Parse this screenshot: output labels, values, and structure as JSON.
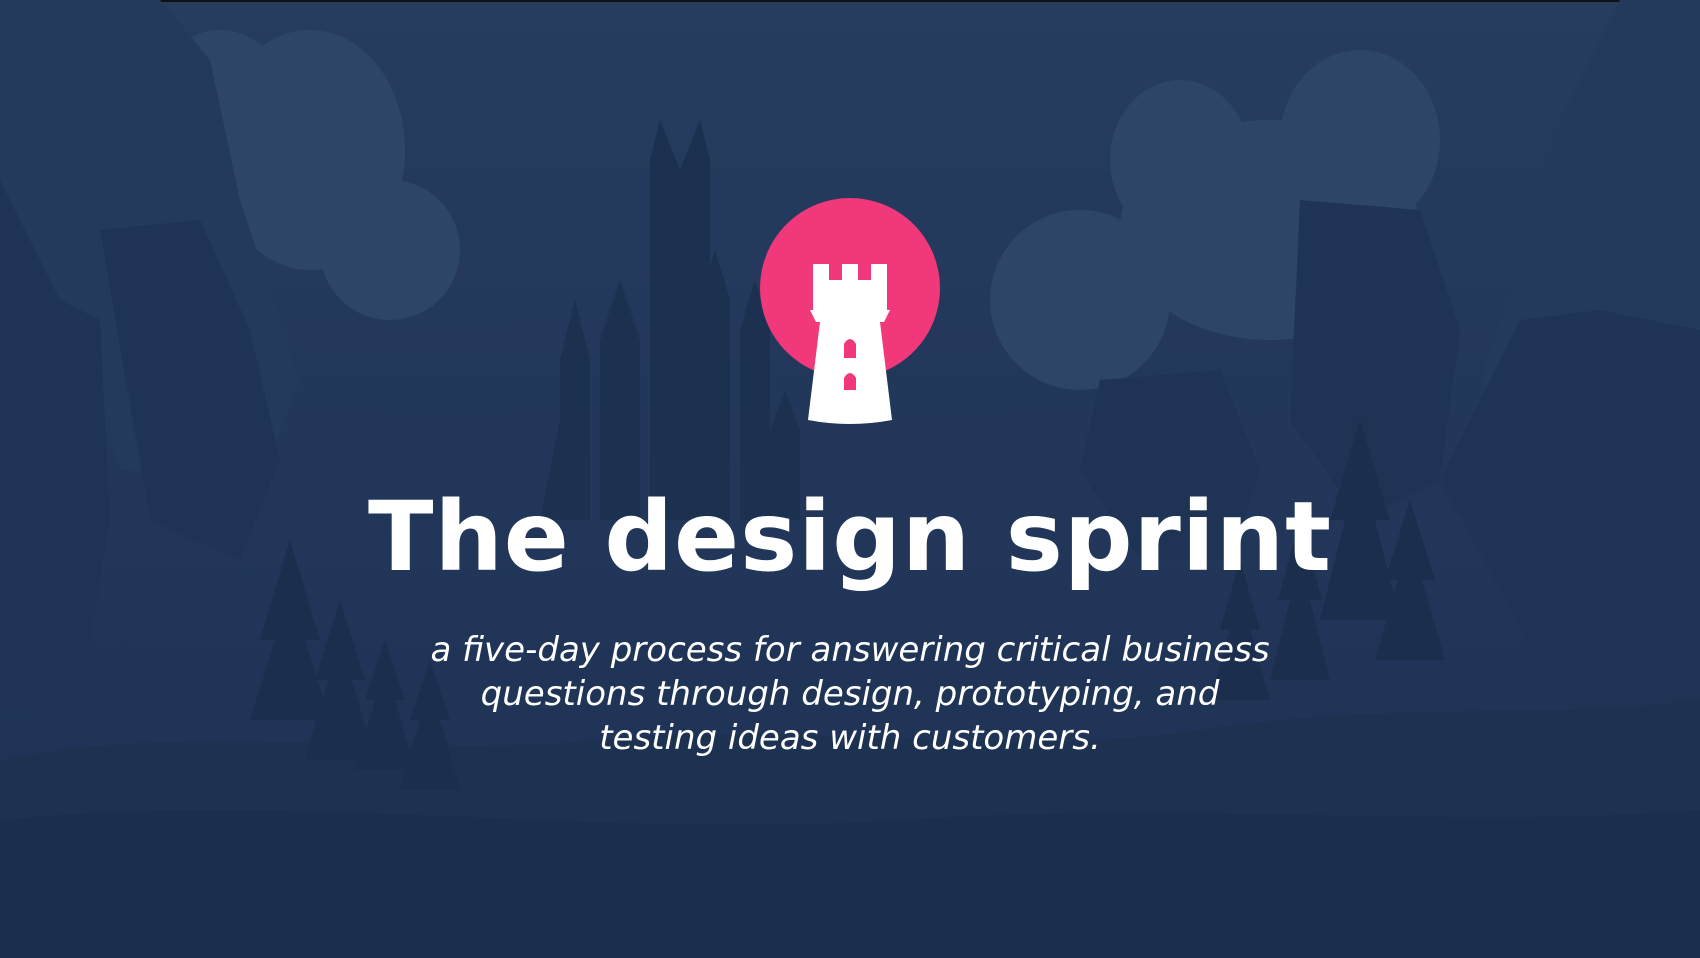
{
  "slide": {
    "title": "The design sprint",
    "subtitle_lines": [
      "a five-day process for answering critical business",
      "questions through design, prototyping, and",
      "testing ideas with customers."
    ]
  },
  "logo": {
    "icon": "castle-tower-icon",
    "circle_color": "#f0387a",
    "tower_color": "#ffffff"
  },
  "background": {
    "illustration": "castle-valley-illustration",
    "base_color": "#213656"
  }
}
